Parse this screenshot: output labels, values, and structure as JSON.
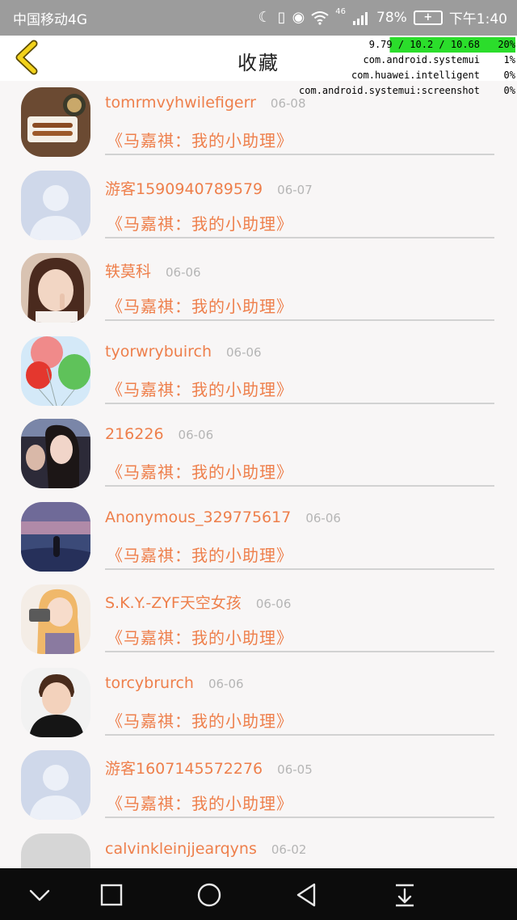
{
  "status_bar": {
    "carrier": "中国移动4G",
    "network_label": "46",
    "battery": "78%",
    "time": "下午1:40"
  },
  "header": {
    "title": "收藏"
  },
  "debug_overlay": {
    "stats": "9.79 / 10.2 / 10.68",
    "total_pct": "20%",
    "rows": [
      {
        "name": "com.android.systemui",
        "pct": "1%"
      },
      {
        "name": "com.huawei.intelligent",
        "pct": "0%"
      },
      {
        "name": "com.android.systemui:screenshot",
        "pct": "0%"
      }
    ]
  },
  "favorites": [
    {
      "name": "tomrmvyhwilefigerr",
      "date": "06-08",
      "snippet": "《马嘉祺：我的小助理》",
      "avatar": "food-photo"
    },
    {
      "name": "游客1590940789579",
      "date": "06-07",
      "snippet": "《马嘉祺：我的小助理》",
      "avatar": "default-silhouette"
    },
    {
      "name": "轶莫科",
      "date": "06-06",
      "snippet": "《马嘉祺：我的小助理》",
      "avatar": "girl-portrait"
    },
    {
      "name": "tyorwrybuirch",
      "date": "06-06",
      "snippet": "《马嘉祺：我的小助理》",
      "avatar": "balloons"
    },
    {
      "name": "216226",
      "date": "06-06",
      "snippet": "《马嘉祺：我的小助理》",
      "avatar": "couple-photo"
    },
    {
      "name": "Anonymous_329775617",
      "date": "06-06",
      "snippet": "《马嘉祺：我的小助理》",
      "avatar": "sea-sunset"
    },
    {
      "name": "S.K.Y.-ZYF天空女孩",
      "date": "06-06",
      "snippet": "《马嘉祺：我的小助理》",
      "avatar": "anime-girl-camera"
    },
    {
      "name": "torcybrurch",
      "date": "06-06",
      "snippet": "《马嘉祺：我的小助理》",
      "avatar": "boy-portrait"
    },
    {
      "name": "游客1607145572276",
      "date": "06-05",
      "snippet": "《马嘉祺：我的小助理》",
      "avatar": "default-silhouette"
    },
    {
      "name": "calvinkleinjjearqyns",
      "date": "06-02",
      "snippet": "",
      "avatar": "text-image"
    }
  ],
  "colors": {
    "accent": "#ee7f4b",
    "date_gray": "#b5b5b5",
    "back_arrow": "#f2d21b",
    "status_bar": "#9c9c9c",
    "nav_bar": "#0c0c0c"
  },
  "nav_icons": [
    "chevron-down-icon",
    "recent-apps-icon",
    "home-icon",
    "back-icon",
    "notification-pull-icon"
  ]
}
